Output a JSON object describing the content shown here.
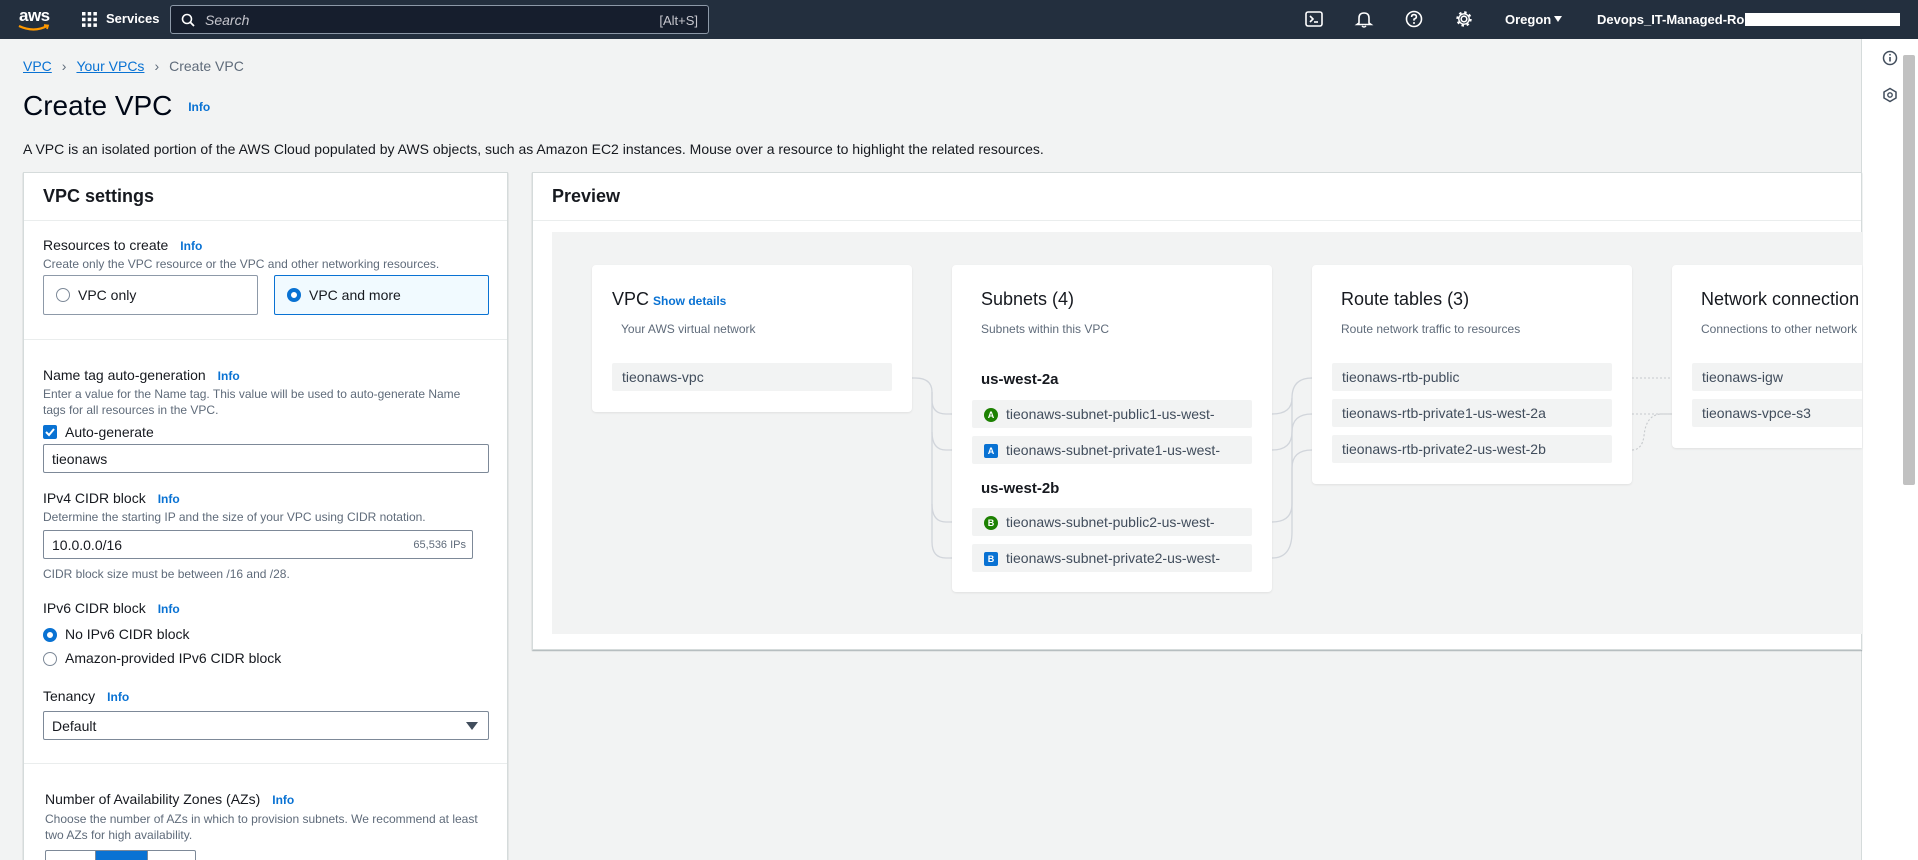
{
  "topnav": {
    "logo": "aws",
    "services_label": "Services",
    "search_placeholder": "Search",
    "search_shortcut": "[Alt+S]",
    "region": "Oregon",
    "account": "Devops_IT-Managed-Role,",
    "icons": [
      "cloudshell-icon",
      "bell-icon",
      "help-icon",
      "gear-icon"
    ]
  },
  "breadcrumb": {
    "items": [
      "VPC",
      "Your VPCs"
    ],
    "current": "Create VPC"
  },
  "page": {
    "title": "Create VPC",
    "info": "Info",
    "description": "A VPC is an isolated portion of the AWS Cloud populated by AWS objects, such as Amazon EC2 instances. Mouse over a resource to highlight the related resources."
  },
  "vpc_settings": {
    "title": "VPC settings",
    "resources": {
      "label": "Resources to create",
      "info": "Info",
      "hint": "Create only the VPC resource or the VPC and other networking resources.",
      "options": [
        "VPC only",
        "VPC and more"
      ],
      "selected": "VPC and more"
    },
    "name_tag": {
      "label": "Name tag auto-generation",
      "info": "Info",
      "hint1": "Enter a value for the Name tag. This value will be used to auto-generate Name",
      "hint2": "tags for all resources in the VPC.",
      "checkbox": "Auto-generate",
      "checked": true,
      "value": "tieonaws"
    },
    "ipv4": {
      "label": "IPv4 CIDR block",
      "info": "Info",
      "hint": "Determine the starting IP and the size of your VPC using CIDR notation.",
      "value": "10.0.0.0/16",
      "suffix": "65,536 IPs",
      "constraint": "CIDR block size must be between /16 and /28."
    },
    "ipv6": {
      "label": "IPv6 CIDR block",
      "info": "Info",
      "options": [
        "No IPv6 CIDR block",
        "Amazon-provided IPv6 CIDR block"
      ],
      "selected": "No IPv6 CIDR block"
    },
    "tenancy": {
      "label": "Tenancy",
      "info": "Info",
      "value": "Default"
    },
    "azs": {
      "label": "Number of Availability Zones (AZs)",
      "info": "Info",
      "hint1": "Choose the number of AZs in which to provision subnets. We recommend at least",
      "hint2": "two AZs for high availability."
    }
  },
  "preview": {
    "title": "Preview",
    "vpc": {
      "title": "VPC",
      "link": "Show details",
      "sub": "Your AWS virtual network",
      "name": "tieonaws-vpc"
    },
    "subnets": {
      "title": "Subnets (4)",
      "sub": "Subnets within this VPC",
      "zones": [
        {
          "name": "us-west-2a",
          "items": [
            {
              "badge": "A",
              "kind": "public",
              "name": "tieonaws-subnet-public1-us-west-"
            },
            {
              "badge": "A",
              "kind": "private",
              "name": "tieonaws-subnet-private1-us-west-"
            }
          ]
        },
        {
          "name": "us-west-2b",
          "items": [
            {
              "badge": "B",
              "kind": "public",
              "name": "tieonaws-subnet-public2-us-west-"
            },
            {
              "badge": "B",
              "kind": "private",
              "name": "tieonaws-subnet-private2-us-west-"
            }
          ]
        }
      ]
    },
    "route_tables": {
      "title": "Route tables (3)",
      "sub": "Route network traffic to resources",
      "items": [
        "tieonaws-rtb-public",
        "tieonaws-rtb-private1-us-west-2a",
        "tieonaws-rtb-private2-us-west-2b"
      ]
    },
    "network": {
      "title": "Network connection",
      "sub": "Connections to other network",
      "items": [
        "tieonaws-igw",
        "tieonaws-vpce-s3"
      ]
    }
  },
  "colors": {
    "nav": "#232f3e",
    "link": "#0972d3",
    "public_badge": "#1d8102",
    "private_badge": "#0972d3"
  }
}
